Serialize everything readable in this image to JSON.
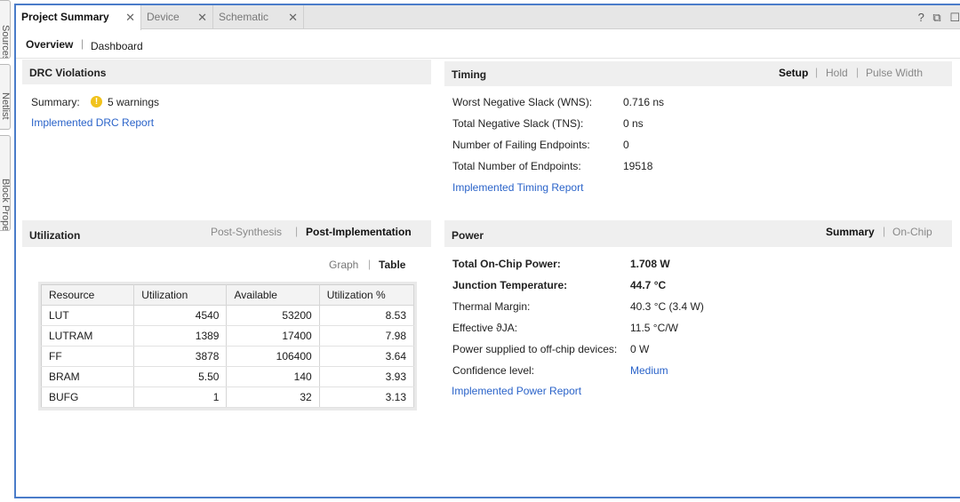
{
  "side_tabs": [
    "Sources",
    "Netlist",
    "Block Properties"
  ],
  "tabs": [
    {
      "label": "Project Summary",
      "active": true
    },
    {
      "label": "Device",
      "active": false
    },
    {
      "label": "Schematic",
      "active": false
    }
  ],
  "window_controls": {
    "help": "?",
    "restore": "⧉",
    "maximize": "☐"
  },
  "subnav": {
    "overview": "Overview",
    "dashboard": "Dashboard"
  },
  "drc": {
    "title": "DRC Violations",
    "summary_label": "Summary:",
    "summary_value": "5 warnings",
    "warn_icon": "!",
    "report_link": "Implemented DRC Report"
  },
  "timing": {
    "title": "Timing",
    "options": [
      "Setup",
      "Hold",
      "Pulse Width"
    ],
    "rows": [
      {
        "label": "Worst Negative Slack (WNS):",
        "value": "0.716 ns"
      },
      {
        "label": "Total Negative Slack (TNS):",
        "value": "0 ns"
      },
      {
        "label": "Number of Failing Endpoints:",
        "value": "0"
      },
      {
        "label": "Total Number of Endpoints:",
        "value": "19518"
      }
    ],
    "report_link": "Implemented Timing Report"
  },
  "utilization": {
    "title": "Utilization",
    "options": [
      "Post-Synthesis",
      "Post-Implementation"
    ],
    "views": [
      "Graph",
      "Table"
    ],
    "columns": [
      "Resource",
      "Utilization",
      "Available",
      "Utilization %"
    ],
    "rows": [
      [
        "LUT",
        "4540",
        "53200",
        "8.53"
      ],
      [
        "LUTRAM",
        "1389",
        "17400",
        "7.98"
      ],
      [
        "FF",
        "3878",
        "106400",
        "3.64"
      ],
      [
        "BRAM",
        "5.50",
        "140",
        "3.93"
      ],
      [
        "BUFG",
        "1",
        "32",
        "3.13"
      ]
    ]
  },
  "power": {
    "title": "Power",
    "options": [
      "Summary",
      "On-Chip"
    ],
    "rows": [
      {
        "label": "Total On-Chip Power:",
        "value": "1.708 W"
      },
      {
        "label": "Junction Temperature:",
        "value": "44.7 °C"
      },
      {
        "label": "Thermal Margin:",
        "value": "40.3 °C (3.4 W)"
      },
      {
        "label": "Effective ϑJA:",
        "value": "11.5 °C/W"
      },
      {
        "label": "Power supplied to off-chip devices:",
        "value": "0 W"
      },
      {
        "label": "Confidence level:",
        "value": "Medium"
      }
    ],
    "report_link": "Implemented Power Report"
  },
  "colors": {
    "accent": "#4a7cc9",
    "link": "#2a63c9",
    "warning": "#f1c21b"
  }
}
